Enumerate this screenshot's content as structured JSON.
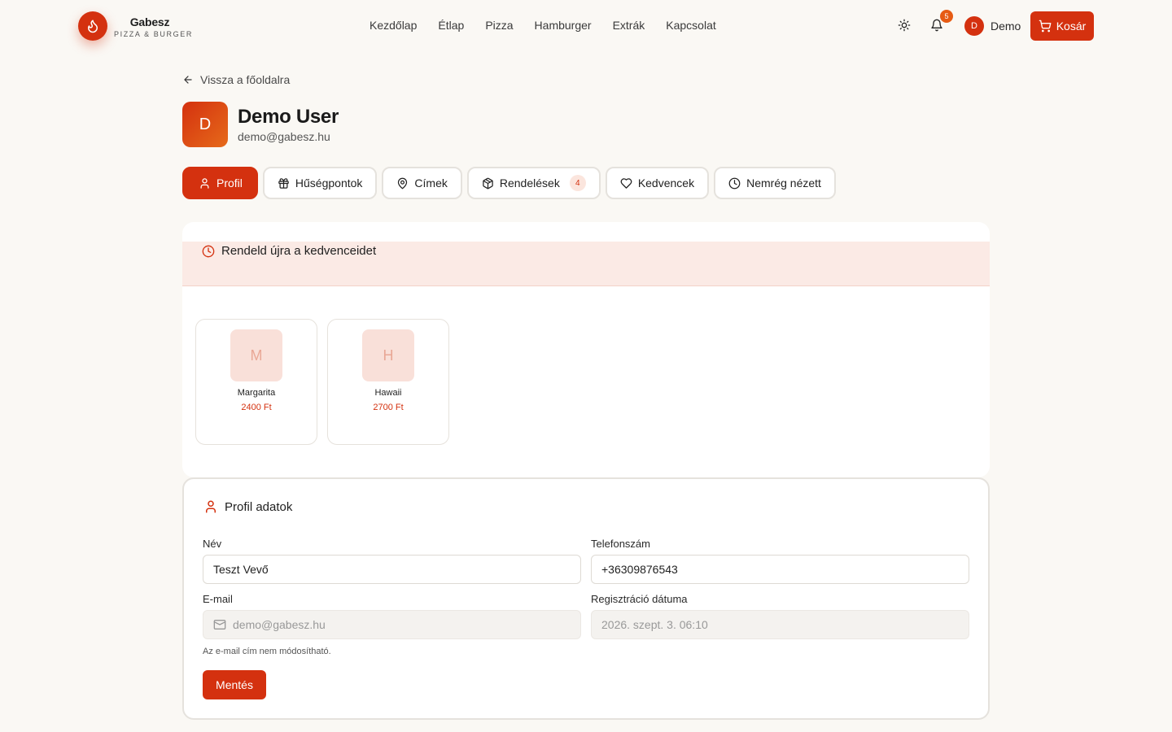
{
  "brand": {
    "name": "Gabesz",
    "subtitle": "PIZZA & BURGER"
  },
  "nav": [
    "Kezdőlap",
    "Étlap",
    "Pizza",
    "Hamburger",
    "Extrák",
    "Kapcsolat"
  ],
  "header": {
    "notification_count": "5",
    "user_initial": "D",
    "user_name": "Demo",
    "cart_label": "Kosár"
  },
  "back_link": "Vissza a főoldalra",
  "profile": {
    "initial": "D",
    "name": "Demo User",
    "email": "demo@gabesz.hu"
  },
  "tabs": [
    {
      "label": "Profil",
      "icon": "user-icon",
      "active": true
    },
    {
      "label": "Hűségpontok",
      "icon": "gift-icon"
    },
    {
      "label": "Címek",
      "icon": "map-pin-icon"
    },
    {
      "label": "Rendelések",
      "icon": "package-icon",
      "count": "4"
    },
    {
      "label": "Kedvencek",
      "icon": "heart-icon"
    },
    {
      "label": "Nemrég nézett",
      "icon": "clock-icon"
    }
  ],
  "reorder": {
    "title": "Rendeld újra a kedvenceidet",
    "items": [
      {
        "initial": "M",
        "name": "Margarita",
        "price": "2400 Ft"
      },
      {
        "initial": "H",
        "name": "Hawaii",
        "price": "2700 Ft"
      }
    ]
  },
  "form": {
    "title": "Profil adatok",
    "name_label": "Név",
    "name_value": "Teszt Vevő",
    "phone_label": "Telefonszám",
    "phone_value": "+36309876543",
    "email_label": "E-mail",
    "email_value": "demo@gabesz.hu",
    "reg_label": "Regisztráció dátuma",
    "reg_value": "2026. szept. 3. 06:10",
    "email_hint": "Az e-mail cím nem módosítható.",
    "save_label": "Mentés"
  },
  "colors": {
    "accent": "#d4310f",
    "background": "#faf8f4",
    "accent_soft": "#fbeae5"
  }
}
